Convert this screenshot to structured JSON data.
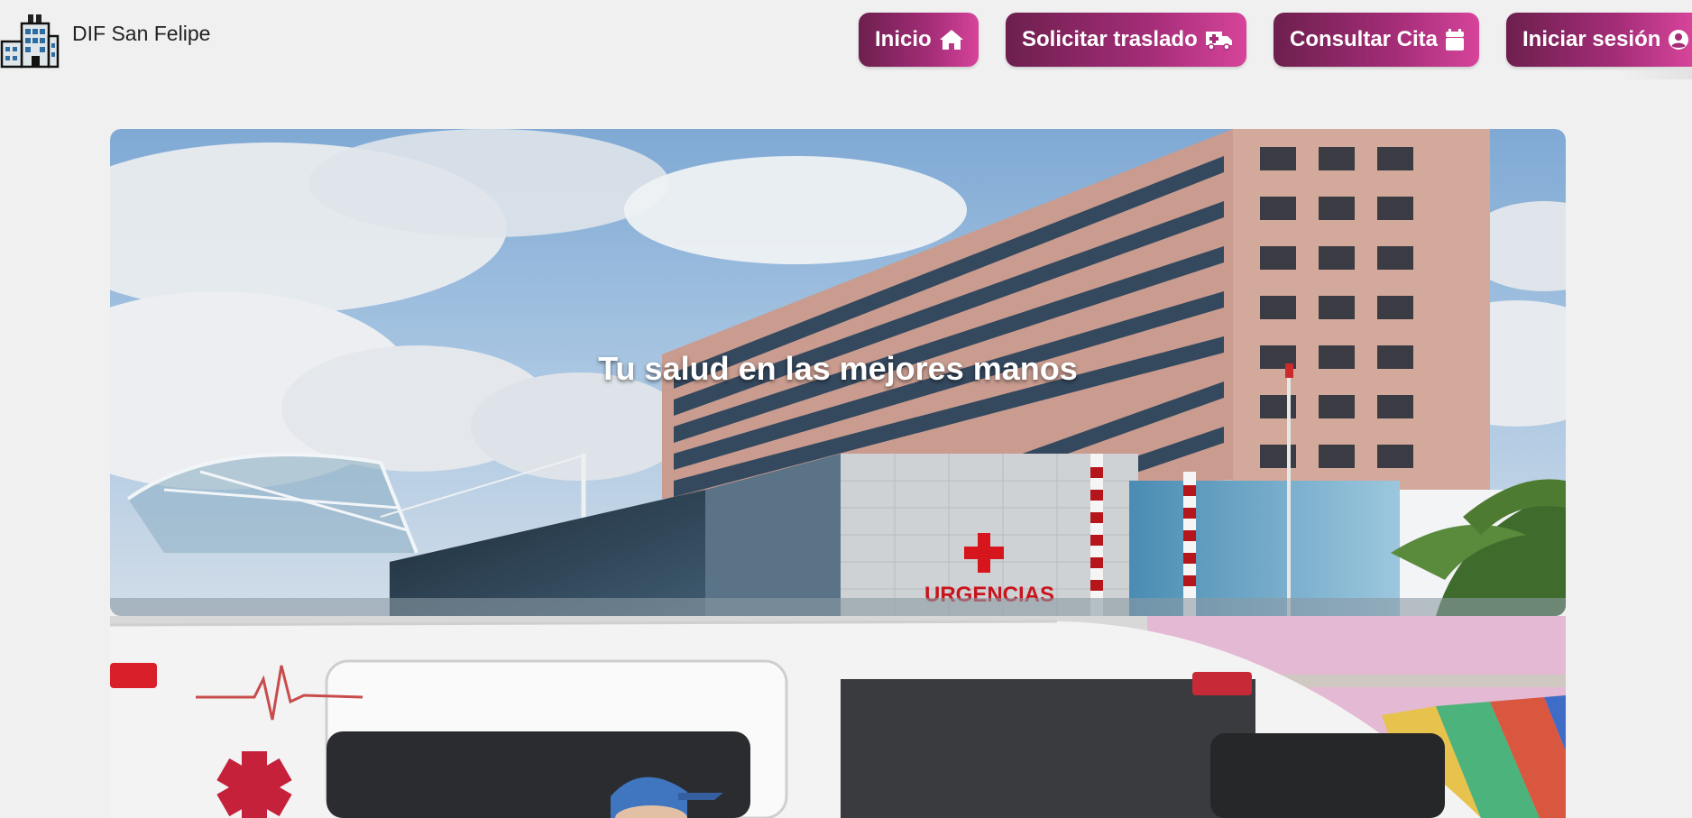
{
  "brand": {
    "name": "DIF San Felipe",
    "logo_icon": "hospital-building-icon"
  },
  "nav": {
    "items": [
      {
        "label": "Inicio",
        "icon": "home-icon"
      },
      {
        "label": "Solicitar traslado",
        "icon": "ambulance-icon"
      },
      {
        "label": "Consultar Cita",
        "icon": "calendar-icon"
      },
      {
        "label": "Iniciar sesión",
        "icon": "user-circle-icon"
      }
    ],
    "gradient": [
      "#6d1f4e",
      "#a52d78",
      "#d6449a"
    ]
  },
  "hero": {
    "caption": "Tu salud en las mejores manos",
    "slide1_signage": {
      "emergency_sign": "URGENCIAS"
    }
  },
  "colors": {
    "background": "#f0f0f0",
    "text": "#222222",
    "accent": "#a52d78"
  }
}
